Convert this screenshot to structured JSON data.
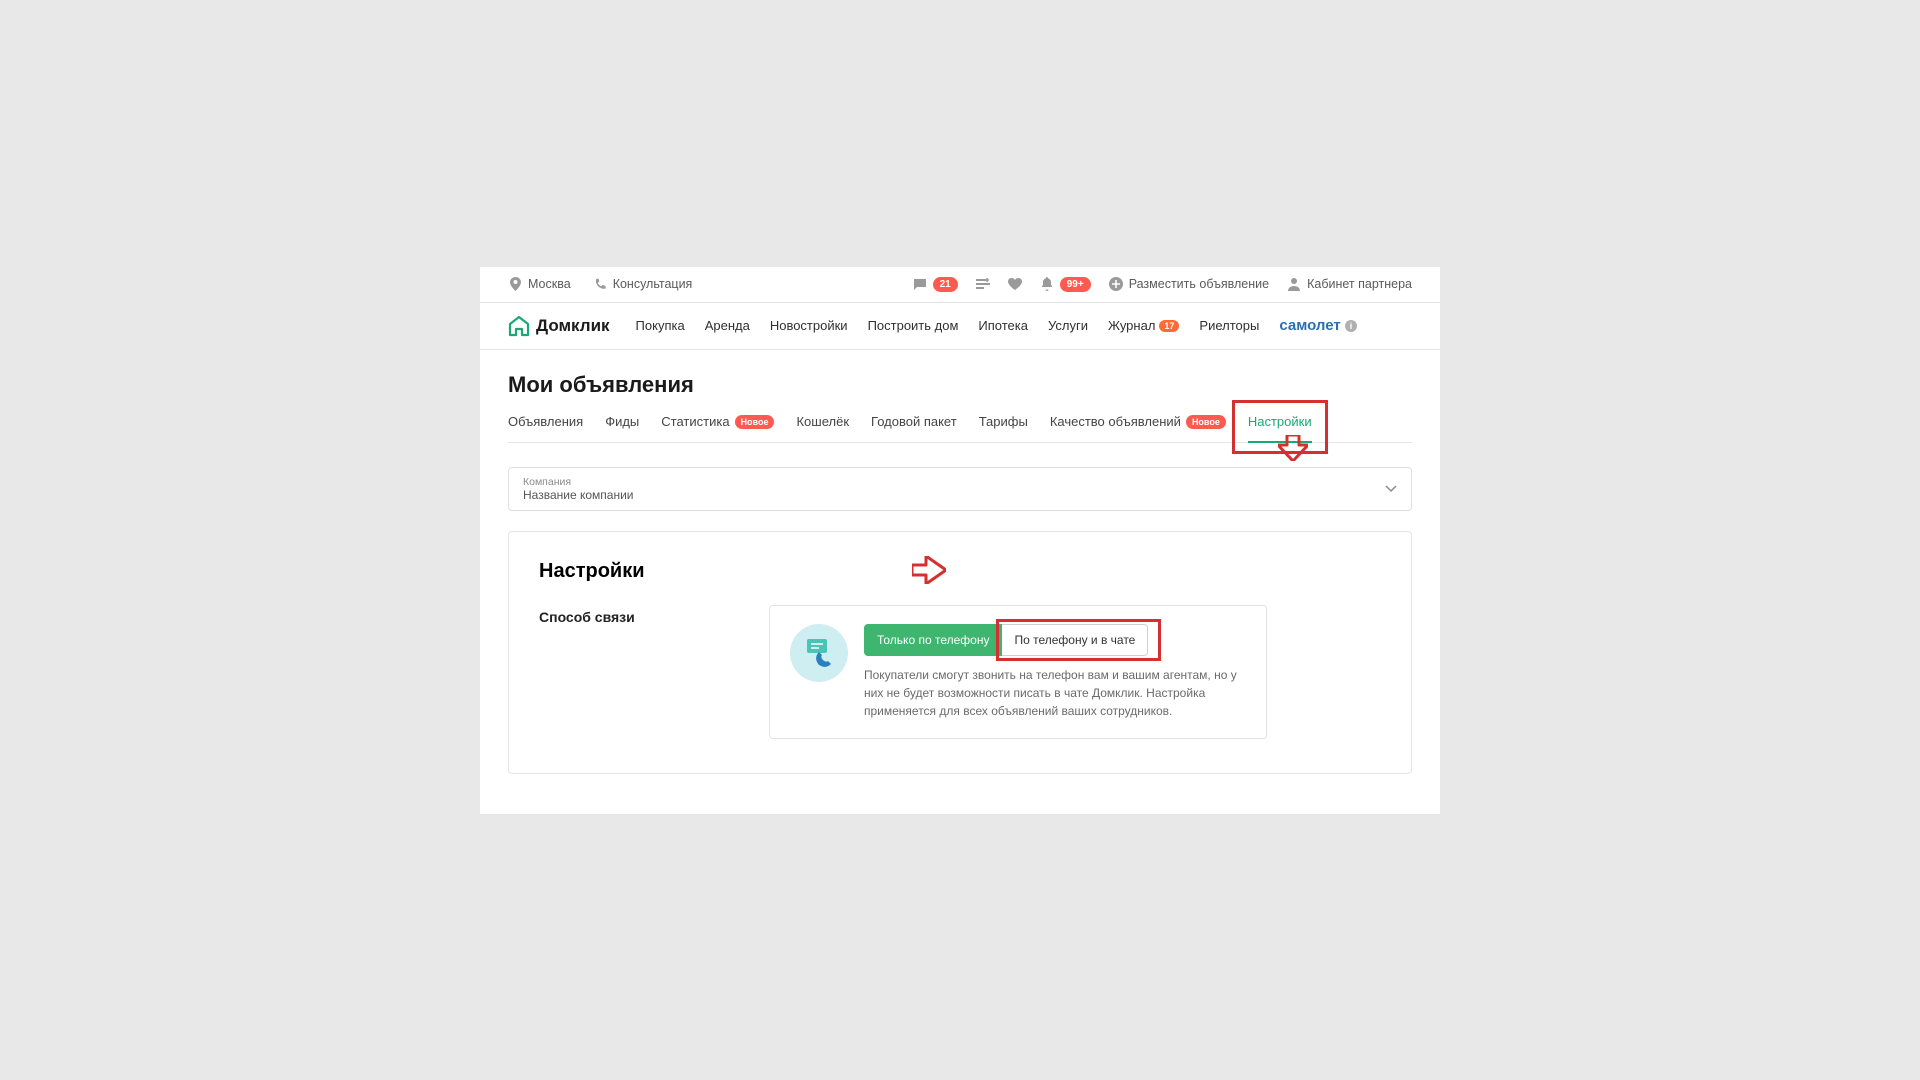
{
  "top": {
    "city": "Москва",
    "consult": "Консультация",
    "chat_count": "21",
    "bell_count": "99+",
    "post_ad": "Разместить объявление",
    "partner": "Кабинет партнера"
  },
  "logo_text": "Домклик",
  "nav": {
    "buy": "Покупка",
    "rent": "Аренда",
    "newbuild": "Новостройки",
    "build": "Построить дом",
    "mortgage": "Ипотека",
    "services": "Услуги",
    "journal": "Журнал",
    "journal_badge": "17",
    "realtors": "Риелторы",
    "samolet": "самолет"
  },
  "page_title": "Мои объявления",
  "tabs": {
    "ads": "Объявления",
    "feeds": "Фиды",
    "stats": "Статистика",
    "wallet": "Кошелёк",
    "annual": "Годовой пакет",
    "tariffs": "Тарифы",
    "quality": "Качество объявлений",
    "settings": "Настройки",
    "new_badge": "Новое"
  },
  "dropdown": {
    "label": "Компания",
    "value": "Название компании"
  },
  "settings": {
    "title": "Настройки",
    "contact_label": "Способ связи",
    "opt_phone": "Только по телефону",
    "opt_phone_chat": "По телефону и в чате",
    "desc": "Покупатели смогут звонить на телефон вам и вашим агентам, но у них не будет возможности писать в чате Домклик. Настройка применяется для всех объявлений ваших сотрудников."
  }
}
